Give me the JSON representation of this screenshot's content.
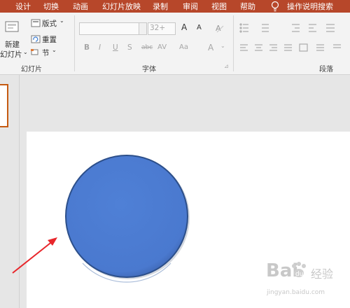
{
  "ribbon_tabs": [
    "设计",
    "切换",
    "动画",
    "幻灯片放映",
    "录制",
    "审阅",
    "视图",
    "帮助",
    "操作说明搜索"
  ],
  "slides_group": {
    "new_slide_line1": "新建",
    "new_slide_line2": "幻灯片",
    "layout": "版式",
    "reset": "重置",
    "section": "节",
    "label": "幻灯片"
  },
  "font_group": {
    "font_size": "32+",
    "label": "字体",
    "bold": "B",
    "italic": "I",
    "underline": "U",
    "shadow": "S",
    "strike": "abc",
    "spacing": "AV",
    "case": "Aa",
    "color": "A",
    "grow": "A",
    "shrink": "A"
  },
  "paragraph_group": {
    "label": "段落"
  },
  "colors": {
    "tab_bar": "#b7472a",
    "circle_fill": "#4a7bd0",
    "circle_stroke": "#2c4f8a",
    "arrow": "#e8262b"
  },
  "watermark": {
    "brand": "Bai",
    "brand2": "经验",
    "url": "jingyan.baidu.com"
  }
}
